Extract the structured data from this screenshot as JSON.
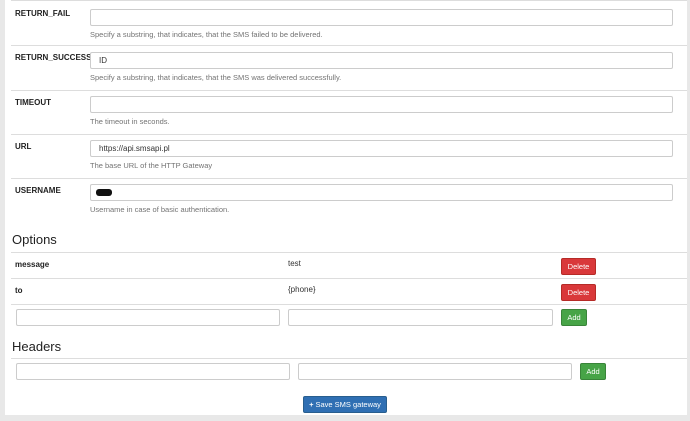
{
  "params": [
    {
      "label": "RETURN_FAIL",
      "value": "",
      "help": "Specify a substring, that indicates, that the SMS failed to be delivered."
    },
    {
      "label": "RETURN_SUCCESS",
      "value": "ID",
      "help": "Specify a substring, that indicates, that the SMS was delivered successfully."
    },
    {
      "label": "TIMEOUT",
      "value": "",
      "help": "The timeout in seconds."
    },
    {
      "label": "URL",
      "value": "https://api.smsapi.pl",
      "help": "The base URL of the HTTP Gateway"
    },
    {
      "label": "USERNAME",
      "value": "",
      "help": "Username in case of basic authentication."
    }
  ],
  "options": {
    "title": "Options",
    "rows": [
      {
        "key": "message",
        "value": "test",
        "delete_label": "Delete"
      },
      {
        "key": "to",
        "value": "{phone}",
        "delete_label": "Delete"
      }
    ],
    "add_label": "Add"
  },
  "headers": {
    "title": "Headers",
    "add_label": "Add"
  },
  "save_label": "Save SMS gateway",
  "colors": {
    "danger": "#d9383a",
    "success": "#47a447",
    "primary": "#2f6fb3"
  }
}
